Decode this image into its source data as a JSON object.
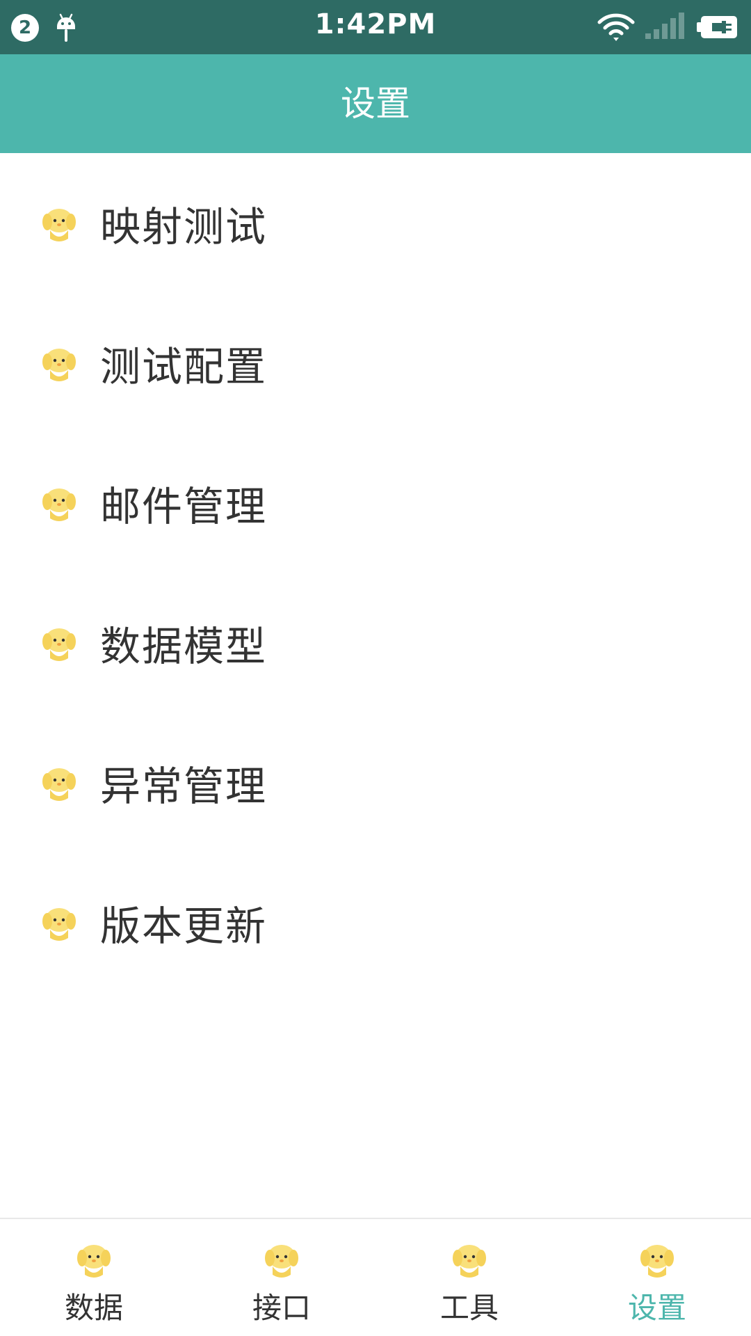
{
  "status_bar": {
    "notification_count": "2",
    "time": "1:42PM",
    "icons": [
      "notification-badge",
      "android-icon",
      "wifi-icon",
      "signal-icon",
      "battery-icon"
    ]
  },
  "header": {
    "title": "设置"
  },
  "menu": {
    "items": [
      {
        "label": "映射测试",
        "icon": "chick-icon"
      },
      {
        "label": "测试配置",
        "icon": "chick-icon"
      },
      {
        "label": "邮件管理",
        "icon": "chick-icon"
      },
      {
        "label": "数据模型",
        "icon": "chick-icon"
      },
      {
        "label": "异常管理",
        "icon": "chick-icon"
      },
      {
        "label": "版本更新",
        "icon": "chick-icon"
      }
    ]
  },
  "tabs": {
    "items": [
      {
        "label": "数据",
        "icon": "chick-icon"
      },
      {
        "label": "接口",
        "icon": "chick-icon"
      },
      {
        "label": "工具",
        "icon": "chick-icon"
      },
      {
        "label": "设置",
        "icon": "chick-icon"
      }
    ],
    "active_index": 3
  },
  "colors": {
    "status_bar": "#2e6b64",
    "header": "#4db6ac",
    "accent": "#4db6ac",
    "text": "#333333",
    "icon_yellow": "#f9e07a"
  }
}
